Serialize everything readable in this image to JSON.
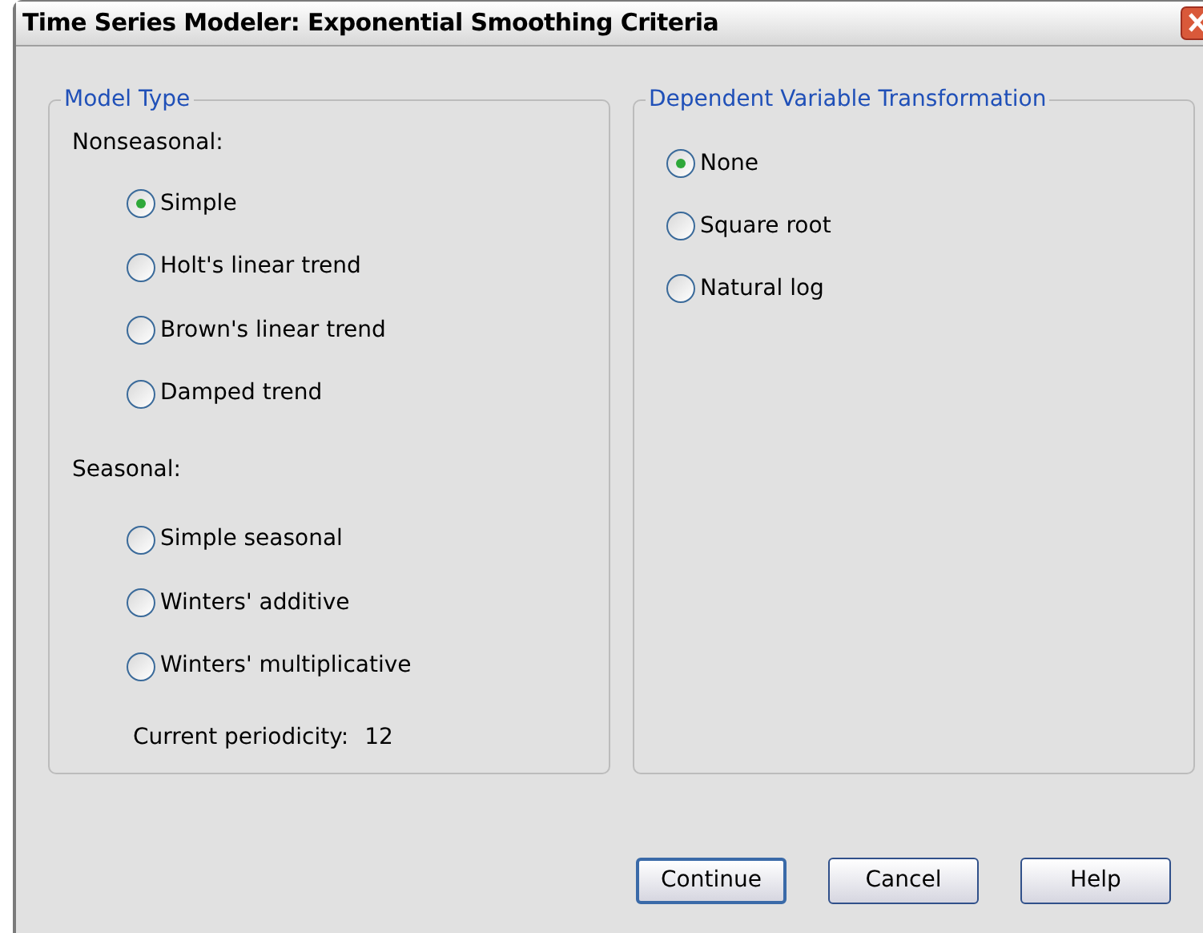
{
  "window": {
    "title": "Time Series Modeler: Exponential Smoothing Criteria"
  },
  "model_type": {
    "title": "Model Type",
    "nonseasonal_label": "Nonseasonal:",
    "nonseasonal_options": [
      {
        "label": "Simple",
        "selected": true
      },
      {
        "label": "Holt's linear trend",
        "selected": false
      },
      {
        "label": "Brown's linear trend",
        "selected": false
      },
      {
        "label": "Damped trend",
        "selected": false
      }
    ],
    "seasonal_label": "Seasonal:",
    "seasonal_options": [
      {
        "label": "Simple seasonal",
        "selected": false
      },
      {
        "label": "Winters' additive",
        "selected": false
      },
      {
        "label": "Winters' multiplicative",
        "selected": false
      }
    ],
    "periodicity_label": "Current periodicity:",
    "periodicity_value": "12"
  },
  "transformation": {
    "title": "Dependent Variable Transformation",
    "options": [
      {
        "label": "None",
        "selected": true
      },
      {
        "label": "Square root",
        "selected": false
      },
      {
        "label": "Natural log",
        "selected": false
      }
    ]
  },
  "buttons": [
    {
      "label": "Continue",
      "default": true
    },
    {
      "label": "Cancel",
      "default": false
    },
    {
      "label": "Help",
      "default": false
    }
  ]
}
